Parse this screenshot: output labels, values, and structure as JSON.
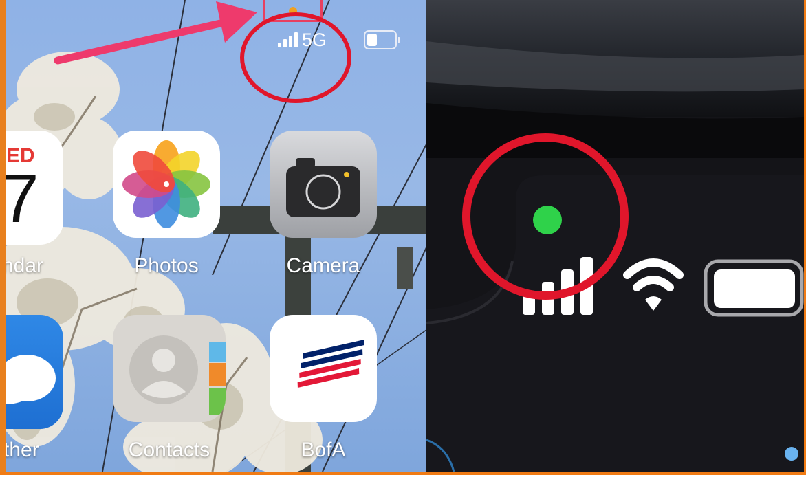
{
  "status_bar": {
    "network": "5G"
  },
  "apps": {
    "calendar": {
      "day_text": "ED",
      "date_text": "7",
      "label": "ndar"
    },
    "photos": {
      "label": "Photos"
    },
    "camera": {
      "label": "Camera"
    },
    "weather": {
      "label": "ther"
    },
    "contacts": {
      "label": "Contacts"
    },
    "bofa": {
      "label": "BofA"
    }
  },
  "indicators": {
    "orange_dot_color": "#f0a020",
    "green_dot_color": "#2fd24a",
    "annotation_color": "#e0162b",
    "arrow_color": "#ee3a6c"
  },
  "icons": [
    "cellular-signal-icon",
    "wifi-icon",
    "battery-icon",
    "camera-lens-icon",
    "contact-silhouette-icon",
    "cloud-icon",
    "photos-flower-icon",
    "bofa-flag-icon"
  ]
}
